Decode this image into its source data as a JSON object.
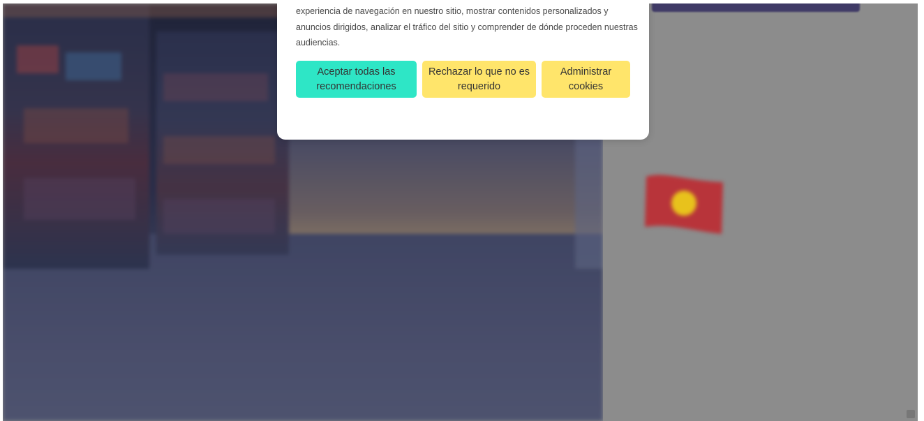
{
  "cookie_modal": {
    "text": "experiencia de navegación en nuestro sitio, mostrar contenidos personalizados y anuncios dirigidos, analizar el tráfico del sitio y comprender de dónde proceden nuestras audiencias.",
    "accept_label": "Aceptar todas las recomendaciones",
    "reject_label": "Rechazar lo que no es requerido",
    "manage_label": "Administrar cookies",
    "colors": {
      "accept": "#2ee6c6",
      "secondary": "#ffe56b"
    }
  },
  "hero": {
    "background": "library-bookshelves-image"
  },
  "sidebar": {
    "flag_icon": "flag-icon"
  }
}
